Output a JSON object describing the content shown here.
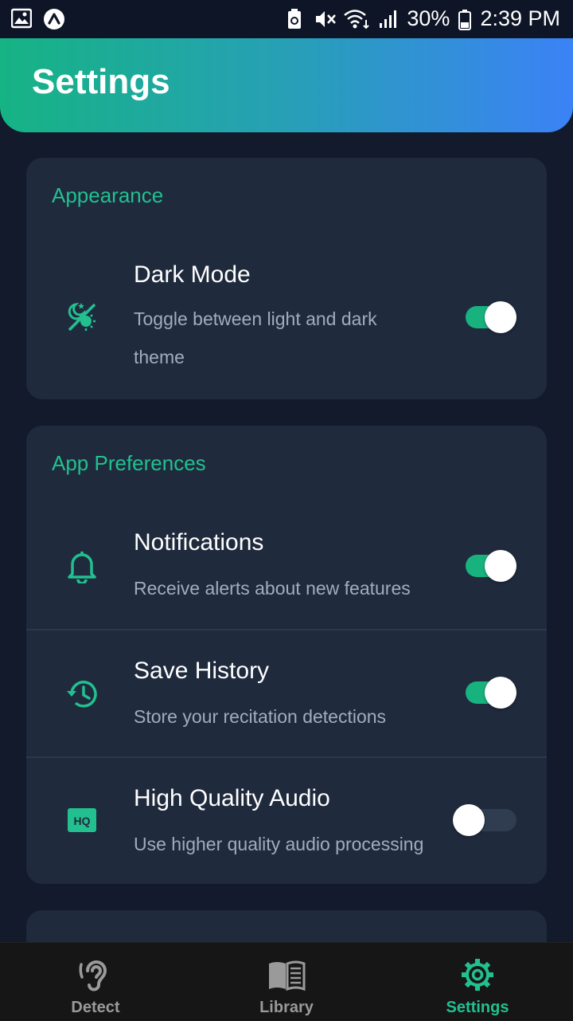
{
  "status_bar": {
    "battery": "30%",
    "time": "2:39 PM"
  },
  "header": {
    "title": "Settings"
  },
  "sections": [
    {
      "title": "Appearance",
      "items": [
        {
          "title": "Dark Mode",
          "subtitle": "Toggle between light and dark theme",
          "icon": "theme-icon",
          "enabled": true
        }
      ]
    },
    {
      "title": "App Preferences",
      "items": [
        {
          "title": "Notifications",
          "subtitle": "Receive alerts about new features",
          "icon": "bell-icon",
          "enabled": true
        },
        {
          "title": "Save History",
          "subtitle": "Store your recitation detections",
          "icon": "history-icon",
          "enabled": true
        },
        {
          "title": "High Quality Audio",
          "subtitle": "Use higher quality audio processing",
          "icon": "hq-icon",
          "enabled": false
        }
      ]
    }
  ],
  "bottom_nav": {
    "items": [
      {
        "label": "Detect",
        "icon": "ear-icon",
        "active": false
      },
      {
        "label": "Library",
        "icon": "book-icon",
        "active": false
      },
      {
        "label": "Settings",
        "icon": "gear-icon",
        "active": true
      }
    ]
  },
  "colors": {
    "accent": "#22c08f",
    "background": "#121a2b",
    "card": "#1f2a3d",
    "nav_inactive": "#9a9a9a"
  }
}
